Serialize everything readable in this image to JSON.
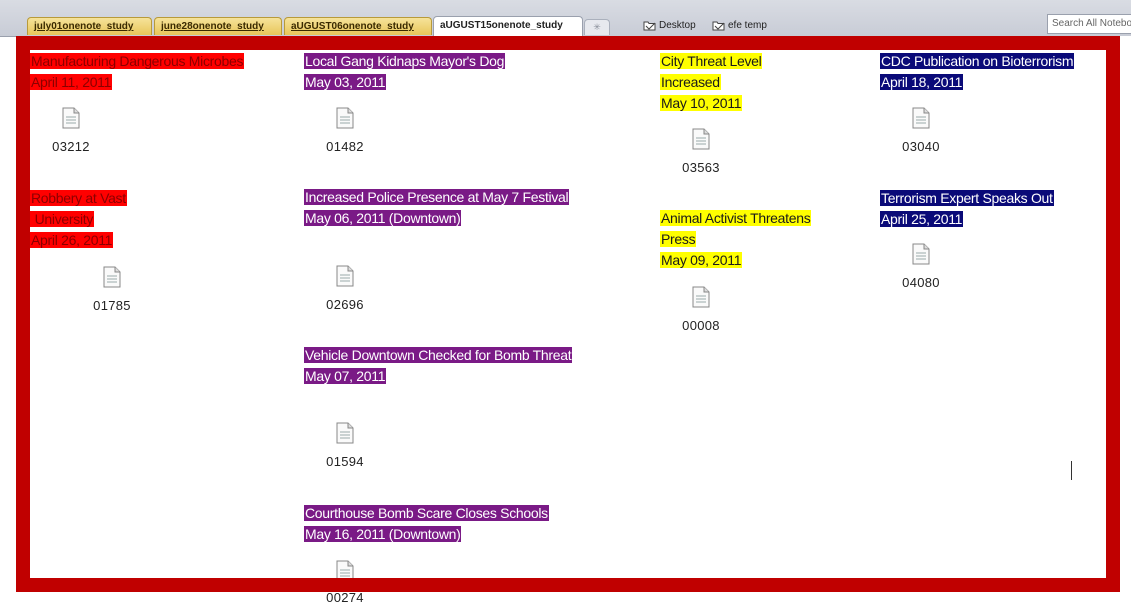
{
  "tabs": [
    {
      "label": "july01onenote_study"
    },
    {
      "label": "june28onenote_study"
    },
    {
      "label": "aUGUST06onenote_study"
    },
    {
      "label": "aUGUST15onenote_study",
      "active": true
    }
  ],
  "locations": [
    {
      "label": "Desktop",
      "icon": "folder-icon"
    },
    {
      "label": "efe temp",
      "icon": "folder-icon"
    }
  ],
  "search": {
    "placeholder": "Search All Notebooks"
  },
  "colors": {
    "red": "#ff0000",
    "purple": "#7a1a86",
    "yellow": "#ffff00",
    "navy": "#0a0a78",
    "frame": "#c00000"
  },
  "entries": [
    {
      "color": "red",
      "lines": [
        "Manufacturing Dangerous Microbes",
        "April 11, 2011"
      ],
      "file": "03212"
    },
    {
      "color": "red",
      "lines": [
        "Robbery at Vast",
        " University",
        "April 26, 2011"
      ],
      "file": "01785"
    },
    {
      "color": "purple",
      "lines": [
        "Local Gang Kidnaps Mayor's Dog",
        "May 03, 2011"
      ],
      "file": "01482"
    },
    {
      "color": "purple",
      "lines": [
        "Increased Police Presence at May 7 Festival",
        "May 06, 2011 (Downtown)"
      ],
      "file": "02696"
    },
    {
      "color": "purple",
      "lines": [
        "Vehicle Downtown Checked for Bomb Threat",
        "May 07, 2011"
      ],
      "file": "01594"
    },
    {
      "color": "purple",
      "lines": [
        "Courthouse Bomb Scare Closes Schools",
        "May 16, 2011 (Downtown)"
      ],
      "file": "00274"
    },
    {
      "color": "yellow",
      "lines": [
        "City Threat Level",
        "Increased",
        "May 10, 2011"
      ],
      "file": "03563"
    },
    {
      "color": "yellow",
      "lines": [
        "Animal Activist Threatens",
        "Press",
        "May 09, 2011"
      ],
      "file": "00008"
    },
    {
      "color": "navy",
      "lines": [
        "CDC Publication on Bioterrorism",
        "April 18, 2011"
      ],
      "file": "03040"
    },
    {
      "color": "navy",
      "lines": [
        "Terrorism Expert Speaks Out",
        "April 25, 2011"
      ],
      "file": "04080"
    }
  ]
}
